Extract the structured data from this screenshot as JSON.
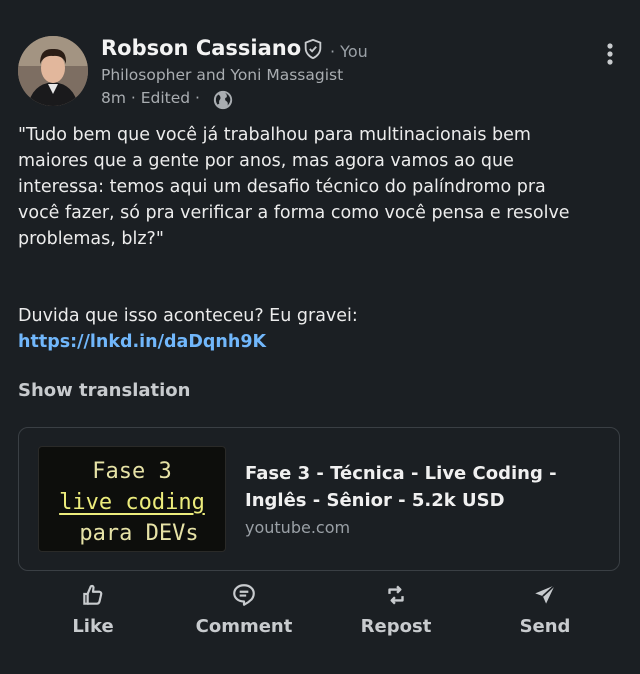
{
  "author": {
    "name": "Robson Cassiano",
    "you_label": "· You",
    "headline": "Philosopher and Yoni Massagist",
    "meta": "8m · Edited ·"
  },
  "post": {
    "body": "\"Tudo bem que você já trabalhou para multinacionais bem\nmaiores que a gente por anos, mas agora vamos ao que\ninteressa: temos aqui um desafio técnico do palíndromo pra\nvocê fazer, só pra verificar a forma como você pensa e resolve\nproblemas, blz?\"",
    "line2": "Duvida que isso aconteceu? Eu gravei:",
    "link": "https://lnkd.in/daDqnh9K",
    "show_translation": "Show translation"
  },
  "link_card": {
    "thumb_line1": "Fase 3",
    "thumb_line2": "live coding",
    "thumb_line3": "para DEVs",
    "title": "Fase 3 - Técnica - Live Coding - Inglês - Sênior - 5.2k USD",
    "domain": "youtube.com"
  },
  "actions": {
    "like": "Like",
    "comment": "Comment",
    "repost": "Repost",
    "send": "Send"
  },
  "icons": {
    "verified": "shield-check-icon",
    "visibility": "globe-icon",
    "more": "more-vertical-icon",
    "like": "thumbs-up-icon",
    "comment": "comment-icon",
    "repost": "repost-icon",
    "send": "send-icon"
  },
  "colors": {
    "background": "#1b1f23",
    "link": "#71b7fb",
    "text": "#ececec",
    "muted": "#a9adb1"
  }
}
